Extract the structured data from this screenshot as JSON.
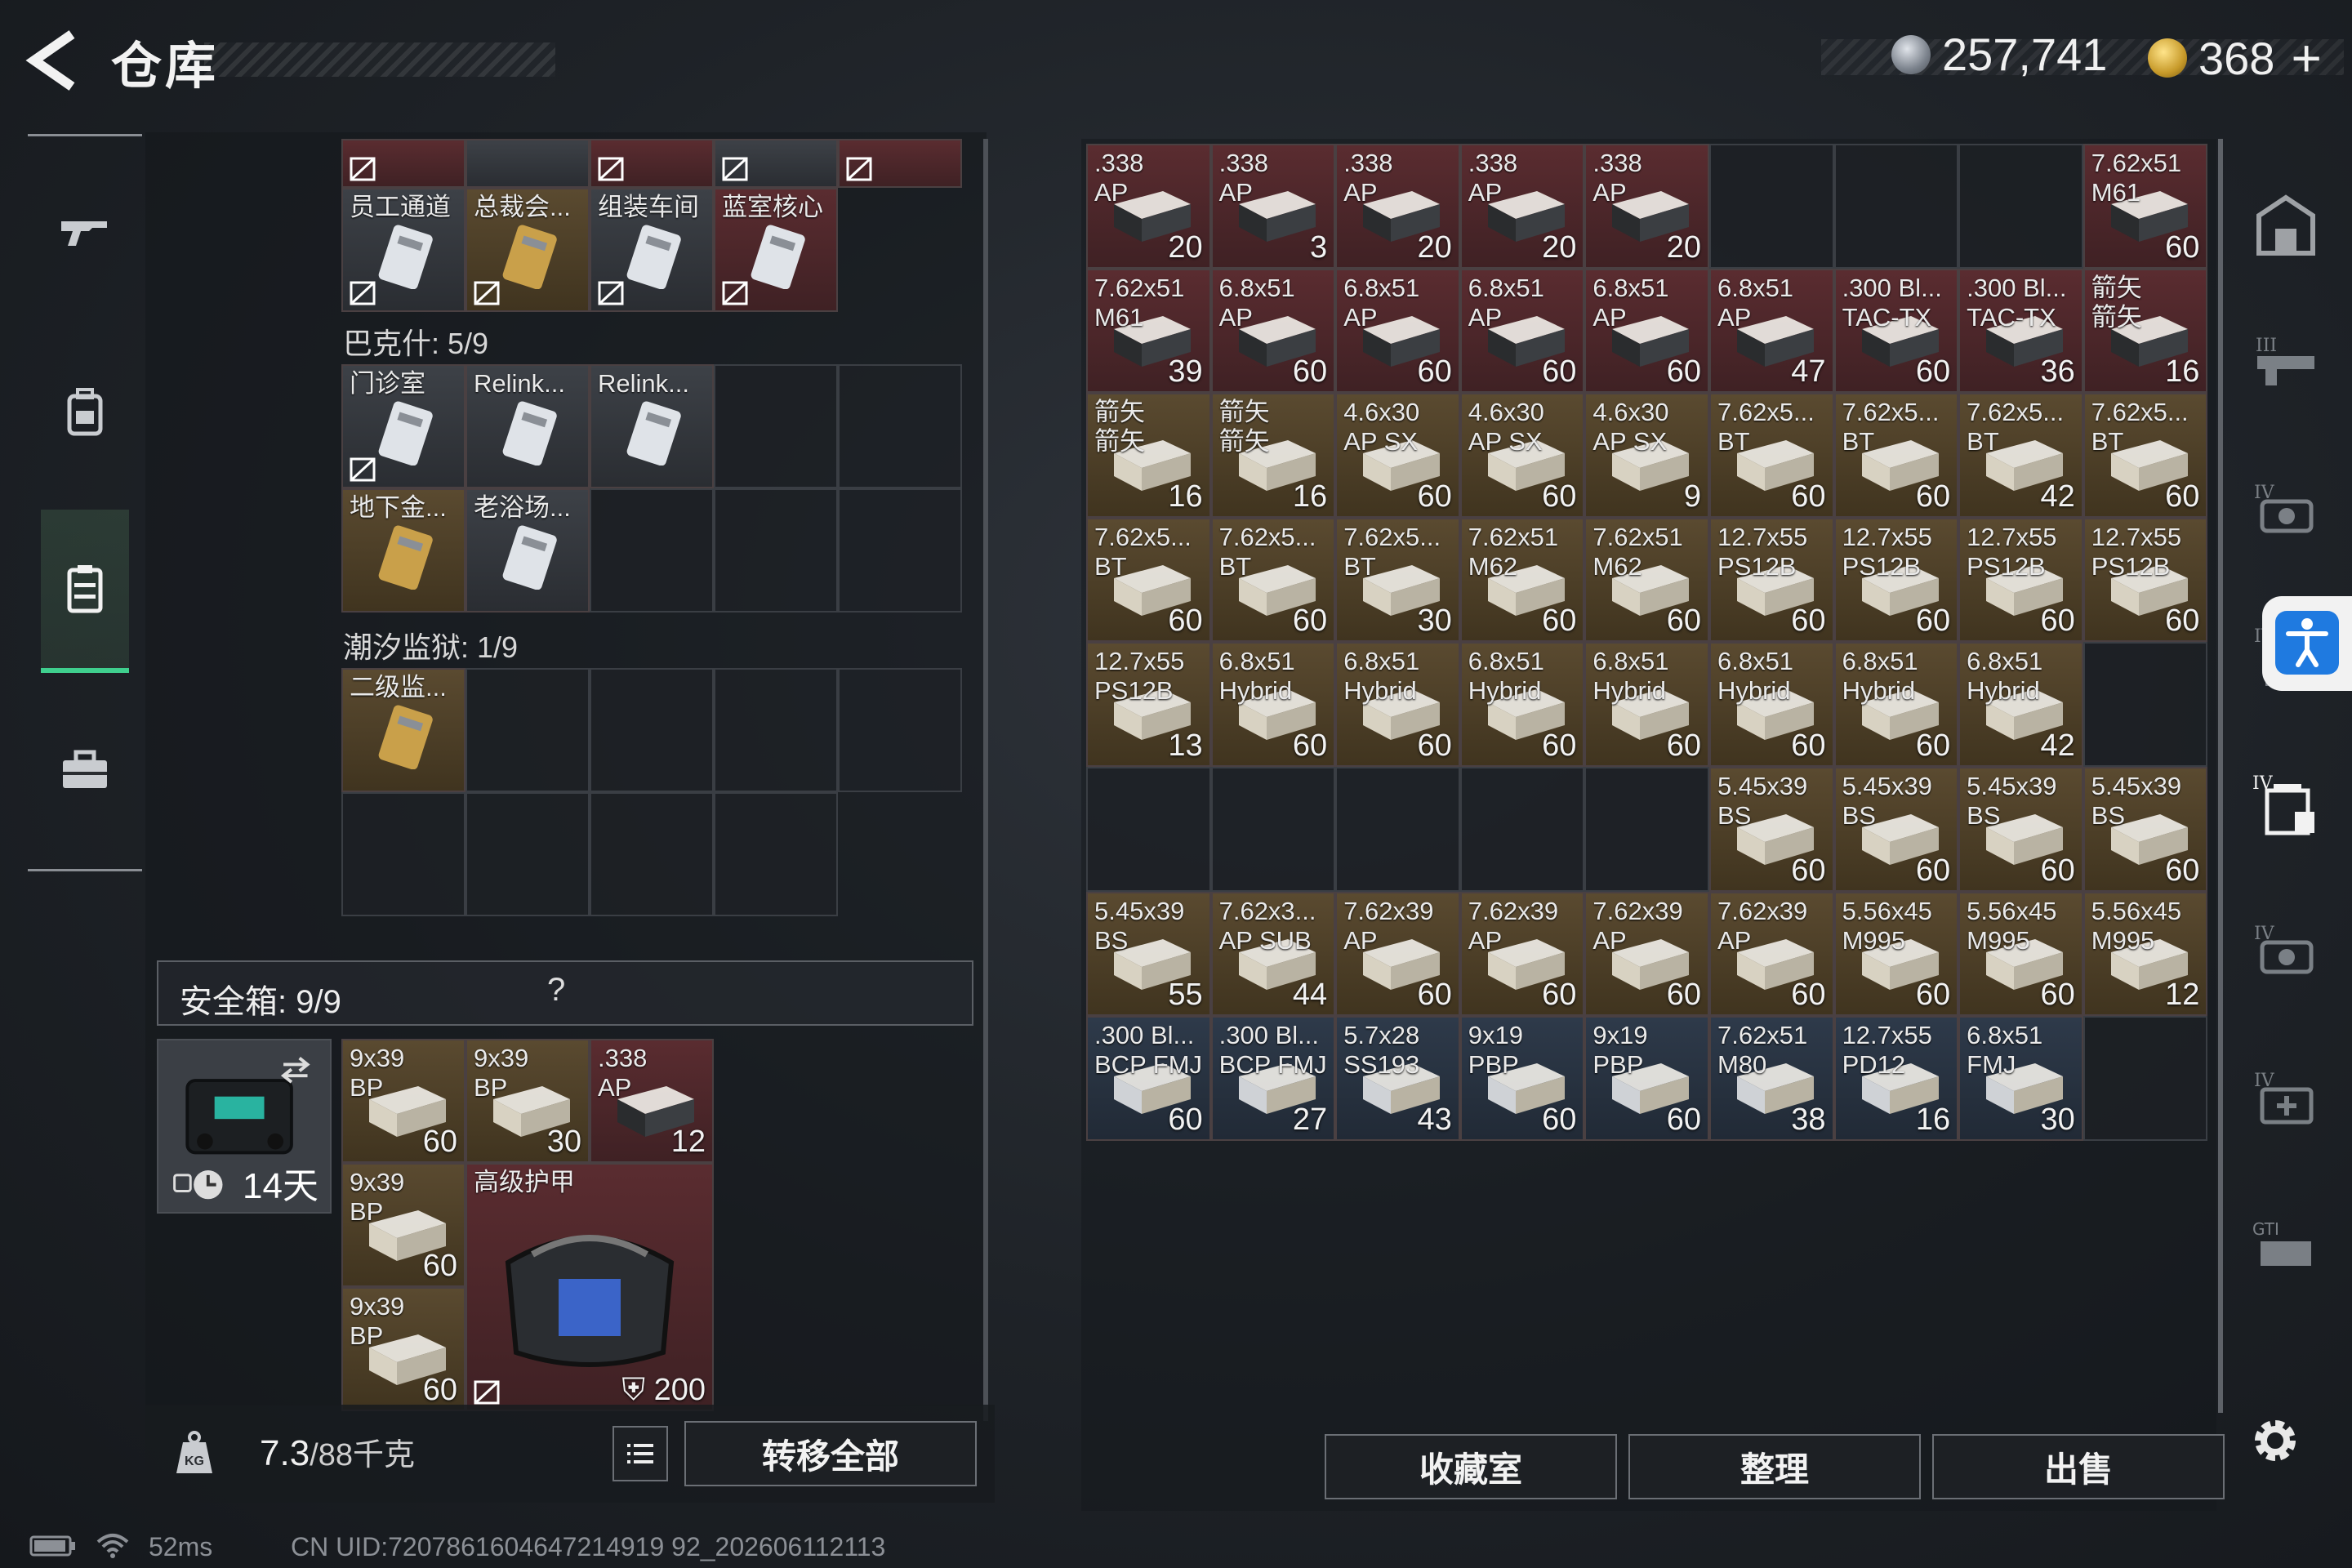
{
  "header": {
    "title": "仓库",
    "silver": "257,741",
    "gold": "368",
    "plus": "+"
  },
  "left_nav": [
    "gun-icon",
    "backpack-icon",
    "storage-icon",
    "toolbox-icon"
  ],
  "keys": {
    "row_top_partial": 5,
    "row1": [
      {
        "name": "员工通道",
        "color": "gray",
        "locked": true
      },
      {
        "name": "总裁会...",
        "color": "gold",
        "locked": true
      },
      {
        "name": "组装车间",
        "color": "gray",
        "locked": true
      },
      {
        "name": "蓝室核心",
        "color": "red",
        "locked": true
      }
    ],
    "section2_label": "巴克什: 5/9",
    "section2": [
      {
        "name": "门诊室",
        "color": "gray",
        "locked": true
      },
      {
        "name": "Relink...",
        "color": "gray",
        "locked": false
      },
      {
        "name": "Relink...",
        "color": "gray",
        "locked": false
      },
      {
        "name": "地下金...",
        "color": "gold",
        "locked": false
      },
      {
        "name": "老浴场...",
        "color": "gray",
        "locked": false
      }
    ],
    "section3_label": "潮汐监狱: 1/9",
    "section3": [
      {
        "name": "二级监...",
        "color": "gold",
        "locked": false
      }
    ]
  },
  "safe": {
    "label": "安全箱: 9/9",
    "help": "?",
    "days": "14天",
    "items": [
      {
        "name": "9x39\nBP",
        "count": "60"
      },
      {
        "name": "9x39\nBP",
        "count": "30"
      },
      {
        "name": ".338\nAP",
        "count": "12"
      },
      {
        "name": "9x39\nBP",
        "count": "60"
      },
      {
        "name": "9x39\nBP",
        "count": "60"
      }
    ],
    "armor": {
      "name": "高级护甲",
      "count": "200"
    }
  },
  "bottom_left": {
    "weight": "7.3",
    "weight_max": "/88千克",
    "transfer_all": "转移全部"
  },
  "inventory": [
    [
      {
        "n": ".338\nAP",
        "c": "20",
        "k": "red"
      },
      {
        "n": ".338\nAP",
        "c": "3",
        "k": "red"
      },
      {
        "n": ".338\nAP",
        "c": "20",
        "k": "red"
      },
      {
        "n": ".338\nAP",
        "c": "20",
        "k": "red"
      },
      {
        "n": ".338\nAP",
        "c": "20",
        "k": "red"
      },
      null,
      null,
      null,
      {
        "n": "7.62x51\nM61",
        "c": "60",
        "k": "red"
      }
    ],
    [
      {
        "n": "7.62x51\nM61",
        "c": "39",
        "k": "red"
      },
      {
        "n": "6.8x51\nAP",
        "c": "60",
        "k": "red"
      },
      {
        "n": "6.8x51\nAP",
        "c": "60",
        "k": "red"
      },
      {
        "n": "6.8x51\nAP",
        "c": "60",
        "k": "red"
      },
      {
        "n": "6.8x51\nAP",
        "c": "60",
        "k": "red"
      },
      {
        "n": "6.8x51\nAP",
        "c": "47",
        "k": "red"
      },
      {
        "n": ".300 Bl...\nTAC-TX",
        "c": "60",
        "k": "red"
      },
      {
        "n": ".300 Bl...\nTAC-TX",
        "c": "36",
        "k": "red"
      },
      {
        "n": "箭矢\n箭矢",
        "c": "16",
        "k": "red"
      }
    ],
    [
      {
        "n": "箭矢\n箭矢",
        "c": "16",
        "k": "gold"
      },
      {
        "n": "箭矢\n箭矢",
        "c": "16",
        "k": "gold"
      },
      {
        "n": "4.6x30\nAP SX",
        "c": "60",
        "k": "gold"
      },
      {
        "n": "4.6x30\nAP SX",
        "c": "60",
        "k": "gold"
      },
      {
        "n": "4.6x30\nAP SX",
        "c": "9",
        "k": "gold"
      },
      {
        "n": "7.62x5...\nBT",
        "c": "60",
        "k": "gold"
      },
      {
        "n": "7.62x5...\nBT",
        "c": "60",
        "k": "gold"
      },
      {
        "n": "7.62x5...\nBT",
        "c": "42",
        "k": "gold"
      },
      {
        "n": "7.62x5...\nBT",
        "c": "60",
        "k": "gold"
      }
    ],
    [
      {
        "n": "7.62x5...\nBT",
        "c": "60",
        "k": "gold"
      },
      {
        "n": "7.62x5...\nBT",
        "c": "60",
        "k": "gold"
      },
      {
        "n": "7.62x5...\nBT",
        "c": "30",
        "k": "gold"
      },
      {
        "n": "7.62x51\nM62",
        "c": "60",
        "k": "gold"
      },
      {
        "n": "7.62x51\nM62",
        "c": "60",
        "k": "gold"
      },
      {
        "n": "12.7x55\nPS12B",
        "c": "60",
        "k": "gold"
      },
      {
        "n": "12.7x55\nPS12B",
        "c": "60",
        "k": "gold"
      },
      {
        "n": "12.7x55\nPS12B",
        "c": "60",
        "k": "gold"
      },
      {
        "n": "12.7x55\nPS12B",
        "c": "60",
        "k": "gold"
      }
    ],
    [
      {
        "n": "12.7x55\nPS12B",
        "c": "13",
        "k": "gold"
      },
      {
        "n": "6.8x51\nHybrid",
        "c": "60",
        "k": "gold"
      },
      {
        "n": "6.8x51\nHybrid",
        "c": "60",
        "k": "gold"
      },
      {
        "n": "6.8x51\nHybrid",
        "c": "60",
        "k": "gold"
      },
      {
        "n": "6.8x51\nHybrid",
        "c": "60",
        "k": "gold"
      },
      {
        "n": "6.8x51\nHybrid",
        "c": "60",
        "k": "gold"
      },
      {
        "n": "6.8x51\nHybrid",
        "c": "60",
        "k": "gold"
      },
      {
        "n": "6.8x51\nHybrid",
        "c": "42",
        "k": "gold"
      },
      null
    ],
    [
      null,
      null,
      null,
      null,
      null,
      {
        "n": "5.45x39\nBS",
        "c": "60",
        "k": "gold"
      },
      {
        "n": "5.45x39\nBS",
        "c": "60",
        "k": "gold"
      },
      {
        "n": "5.45x39\nBS",
        "c": "60",
        "k": "gold"
      },
      {
        "n": "5.45x39\nBS",
        "c": "60",
        "k": "gold"
      }
    ],
    [
      {
        "n": "5.45x39\nBS",
        "c": "55",
        "k": "gold"
      },
      {
        "n": "7.62x3...\nAP SUB",
        "c": "44",
        "k": "gold"
      },
      {
        "n": "7.62x39\nAP",
        "c": "60",
        "k": "gold"
      },
      {
        "n": "7.62x39\nAP",
        "c": "60",
        "k": "gold"
      },
      {
        "n": "7.62x39\nAP",
        "c": "60",
        "k": "gold"
      },
      {
        "n": "7.62x39\nAP",
        "c": "60",
        "k": "gold"
      },
      {
        "n": "5.56x45\nM995",
        "c": "60",
        "k": "gold"
      },
      {
        "n": "5.56x45\nM995",
        "c": "60",
        "k": "gold"
      },
      {
        "n": "5.56x45\nM995",
        "c": "12",
        "k": "gold"
      }
    ],
    [
      {
        "n": ".300 Bl...\nBCP FMJ",
        "c": "60",
        "k": "blue"
      },
      {
        "n": ".300 Bl...\nBCP FMJ",
        "c": "27",
        "k": "blue"
      },
      {
        "n": "5.7x28\nSS193",
        "c": "43",
        "k": "blue"
      },
      {
        "n": "9x19\nPBP",
        "c": "60",
        "k": "blue"
      },
      {
        "n": "9x19\nPBP",
        "c": "60",
        "k": "blue"
      },
      {
        "n": "7.62x51\nM80",
        "c": "38",
        "k": "blue"
      },
      {
        "n": "12.7x55\nPD12",
        "c": "16",
        "k": "blue"
      },
      {
        "n": "6.8x51\nFMJ",
        "c": "30",
        "k": "blue"
      },
      null
    ]
  ],
  "bottom_right": {
    "collection": "收藏室",
    "organize": "整理",
    "sell": "出售"
  },
  "footer": {
    "ping": "52ms",
    "uid": "CN UID:7207861604647214919 92_202606112113"
  },
  "colors": {
    "accent_green": "#3fcf8e",
    "item_red": "#5a2c30",
    "item_gold": "#5a4a30",
    "item_blue": "#2e3a4a"
  }
}
